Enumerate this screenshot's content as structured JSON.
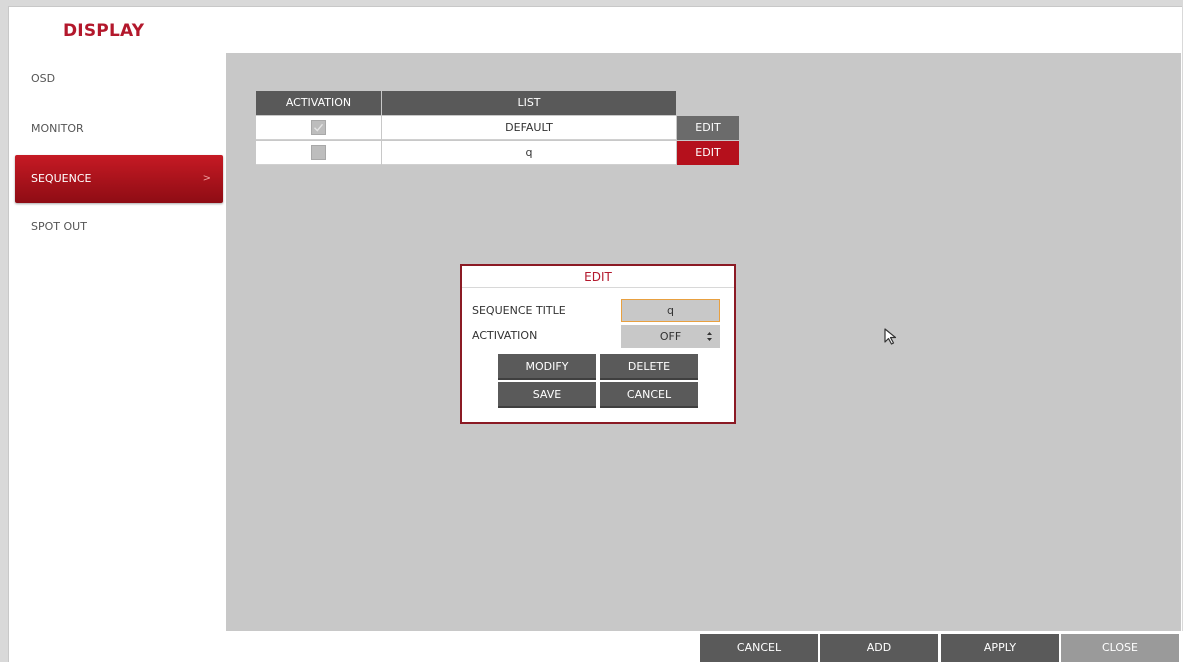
{
  "header": {
    "title": "DISPLAY"
  },
  "sidebar": {
    "items": [
      {
        "label": "OSD"
      },
      {
        "label": "MONITOR"
      },
      {
        "label": "SEQUENCE",
        "chevron": ">"
      },
      {
        "label": "SPOT OUT"
      }
    ],
    "active_index": 2
  },
  "list": {
    "headers": {
      "activation": "ACTIVATION",
      "list": "LIST"
    },
    "rows": [
      {
        "checked": true,
        "name": "DEFAULT",
        "edit_label": "EDIT"
      },
      {
        "checked": false,
        "name": "q",
        "edit_label": "EDIT"
      }
    ]
  },
  "dialog": {
    "title": "EDIT",
    "sequence_title_label": "SEQUENCE TITLE",
    "sequence_title_value": "q",
    "activation_label": "ACTIVATION",
    "activation_value": "OFF",
    "buttons": {
      "modify": "MODIFY",
      "delete": "DELETE",
      "save": "SAVE",
      "cancel": "CANCEL"
    }
  },
  "footer": {
    "cancel": "CANCEL",
    "add": "ADD",
    "apply": "APPLY",
    "close": "CLOSE"
  },
  "colors": {
    "accent": "#b3182c",
    "active_item": "#c61a24",
    "panel": "#c8c8c8",
    "button": "#5a5a5a"
  },
  "icons": {
    "cursor": "mouse-pointer-icon",
    "spin": "up-down-spinner-icon",
    "check": "checkmark-icon"
  }
}
